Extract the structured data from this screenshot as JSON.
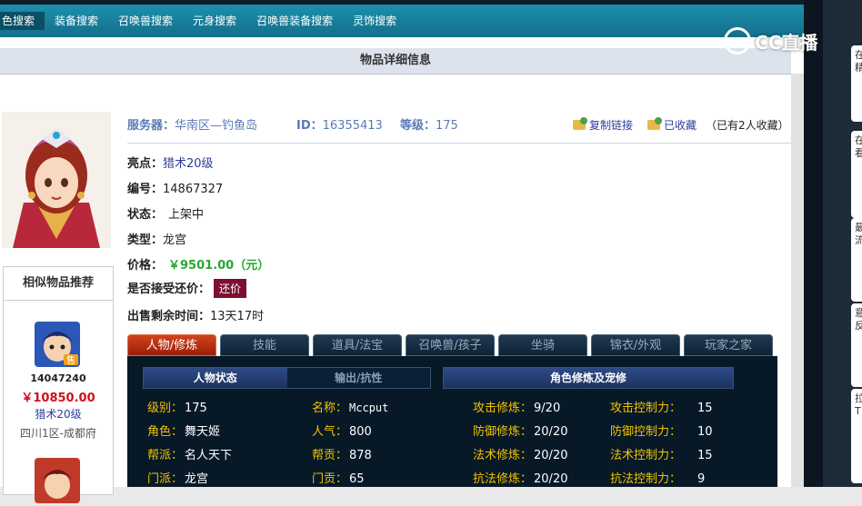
{
  "nav": {
    "items": [
      "色搜索",
      "装备搜索",
      "召唤兽搜索",
      "元身搜索",
      "召唤兽装备搜索",
      "灵饰搜索"
    ]
  },
  "overlay": {
    "cc_logo_text": "CC直播",
    "side_tabs": [
      "在\n精",
      "在\n看",
      "最\n流",
      "意\n反",
      "拉\nT"
    ]
  },
  "detail": {
    "header_title": "物品详细信息",
    "server_label": "服务器：",
    "server_value": "华南区—钓鱼岛",
    "id_label": "ID：",
    "id_value": "16355413",
    "level_label": "等级：",
    "level_value": "175",
    "copy_link": "复制链接",
    "favorited": "已收藏",
    "favorite_count": "（已有2人收藏）",
    "highlight_label": "亮点：",
    "highlight_value": "猎术20级",
    "number_label": "编号：",
    "number_value": "14867327",
    "status_label": "状态：",
    "status_value": "上架中",
    "type_label": "类型：",
    "type_value": "龙宫",
    "price_label": "价格：",
    "price_value": "￥9501.00（元）",
    "bargain_label": "是否接受还价：",
    "bargain_button": "还价",
    "remaining_label": "出售剩余时间：",
    "remaining_value": "13天17时"
  },
  "similar": {
    "title": "相似物品推荐",
    "badge": "售",
    "item": {
      "id": "14047240",
      "price": "￥10850.00",
      "skill": "猎术20级",
      "server": "四川1区-成都府"
    }
  },
  "tabs": [
    "人物/修炼",
    "技能",
    "道具/法宝",
    "召唤兽/孩子",
    "坐骑",
    "锦衣/外观",
    "玩家之家"
  ],
  "panel": {
    "sub_tab_status": "人物状态",
    "sub_tab_output": "输出/抗性",
    "sub_tab_cultivation": "角色修炼及宠修",
    "stats_left": [
      {
        "k": "级别：",
        "v": "175"
      },
      {
        "k": "角色：",
        "v": "舞天姬"
      },
      {
        "k": "帮派：",
        "v": "名人天下"
      },
      {
        "k": "门派：",
        "v": "龙宫"
      }
    ],
    "stats_mid": [
      {
        "k": "名称：",
        "v": "Mccput"
      },
      {
        "k": "人气：",
        "v": "800"
      },
      {
        "k": "帮贡：",
        "v": "878"
      },
      {
        "k": "门贡：",
        "v": "65"
      }
    ],
    "stats_cult": [
      {
        "k": "攻击修炼：",
        "v": "9/20"
      },
      {
        "k": "防御修炼：",
        "v": "20/20"
      },
      {
        "k": "法术修炼：",
        "v": "20/20"
      },
      {
        "k": "抗法修炼：",
        "v": "20/20"
      }
    ],
    "stats_ctrl": [
      {
        "k": "攻击控制力：",
        "v": "15"
      },
      {
        "k": "防御控制力：",
        "v": "10"
      },
      {
        "k": "法术控制力：",
        "v": "15"
      },
      {
        "k": "抗法控制力：",
        "v": "9"
      }
    ]
  }
}
